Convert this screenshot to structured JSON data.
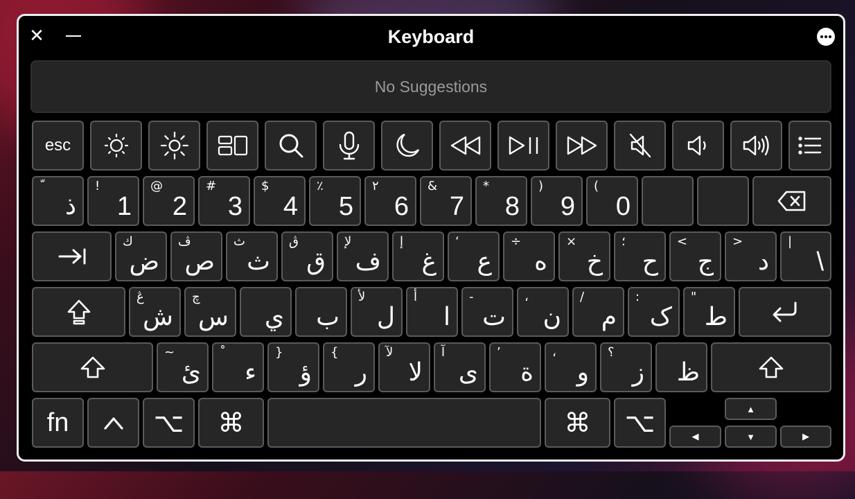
{
  "window": {
    "title": "Keyboard"
  },
  "suggestions": {
    "text": "No Suggestions"
  },
  "function_row": [
    {
      "name": "esc-key",
      "label": "esc"
    },
    {
      "name": "brightness-down-key",
      "icon": "sun-small-icon"
    },
    {
      "name": "brightness-up-key",
      "icon": "sun-large-icon"
    },
    {
      "name": "mission-control-key",
      "icon": "mission-control-icon"
    },
    {
      "name": "spotlight-key",
      "icon": "search-icon"
    },
    {
      "name": "dictation-key",
      "icon": "microphone-icon"
    },
    {
      "name": "focus-key",
      "icon": "moon-icon"
    },
    {
      "name": "rewind-key",
      "icon": "rewind-icon"
    },
    {
      "name": "play-pause-key",
      "icon": "play-pause-icon"
    },
    {
      "name": "fast-forward-key",
      "icon": "fast-forward-icon"
    },
    {
      "name": "mute-key",
      "icon": "speaker-mute-icon"
    },
    {
      "name": "volume-down-key",
      "icon": "speaker-low-icon"
    },
    {
      "name": "volume-up-key",
      "icon": "speaker-high-icon"
    },
    {
      "name": "menu-key",
      "icon": "list-icon"
    }
  ],
  "number_row": [
    {
      "sec": "ّ",
      "pri": "ذ"
    },
    {
      "sec": "!",
      "pri": "1"
    },
    {
      "sec": "@",
      "pri": "2"
    },
    {
      "sec": "#",
      "pri": "3"
    },
    {
      "sec": "$",
      "pri": "4"
    },
    {
      "sec": "٪",
      "pri": "5"
    },
    {
      "sec": "۲",
      "pri": "6"
    },
    {
      "sec": "&",
      "pri": "7"
    },
    {
      "sec": "*",
      "pri": "8"
    },
    {
      "sec": ")",
      "pri": "9"
    },
    {
      "sec": "(",
      "pri": "0"
    },
    {
      "sec": "",
      "pri": ""
    },
    {
      "sec": "",
      "pri": ""
    }
  ],
  "top_row": [
    {
      "sec": "ك",
      "pri": "ض"
    },
    {
      "sec": "ڤ",
      "pri": "ص"
    },
    {
      "sec": "ث",
      "pri": "ث"
    },
    {
      "sec": "ڨ",
      "pri": "ق"
    },
    {
      "sec": "لإ",
      "pri": "ف"
    },
    {
      "sec": "إ",
      "pri": "غ"
    },
    {
      "sec": "ʻ",
      "pri": "ع"
    },
    {
      "sec": "÷",
      "pri": "ه"
    },
    {
      "sec": "×",
      "pri": "خ"
    },
    {
      "sec": "؛",
      "pri": "ح"
    },
    {
      "sec": "<",
      "pri": "ج"
    },
    {
      "sec": ">",
      "pri": "د"
    },
    {
      "sec": "|",
      "pri": "\\"
    }
  ],
  "home_row": [
    {
      "sec": "ڠ",
      "pri": "ش"
    },
    {
      "sec": "چ",
      "pri": "س"
    },
    {
      "sec": "",
      "pri": "ي"
    },
    {
      "sec": "",
      "pri": "ب"
    },
    {
      "sec": "لأ",
      "pri": "ل"
    },
    {
      "sec": "أ",
      "pri": "ا"
    },
    {
      "sec": "-",
      "pri": "ت"
    },
    {
      "sec": "،",
      "pri": "ن"
    },
    {
      "sec": "/",
      "pri": "م"
    },
    {
      "sec": ":",
      "pri": "ک"
    },
    {
      "sec": "\"",
      "pri": "ط"
    }
  ],
  "bottom_row": [
    {
      "sec": "~",
      "pri": "ئ"
    },
    {
      "sec": "ْ",
      "pri": "ء"
    },
    {
      "sec": "}",
      "pri": "ؤ"
    },
    {
      "sec": "{",
      "pri": "ر"
    },
    {
      "sec": "لآ",
      "pri": "لا"
    },
    {
      "sec": "آ",
      "pri": "ى"
    },
    {
      "sec": "’",
      "pri": "ة"
    },
    {
      "sec": "،",
      "pri": "و"
    },
    {
      "sec": "؟",
      "pri": "ز"
    },
    {
      "sec": "",
      "pri": "ظ"
    }
  ],
  "modifiers": {
    "fn": "fn",
    "control": "^",
    "option": "⌥",
    "command": "⌘",
    "command_right": "⌘",
    "option_right": "⌥",
    "tab": "⇥",
    "backspace": "⌫",
    "return": "↵",
    "caps": "⇪",
    "shift": "⇧",
    "arrow_up": "▲",
    "arrow_left": "◀",
    "arrow_down": "▼",
    "arrow_right": "▶"
  }
}
